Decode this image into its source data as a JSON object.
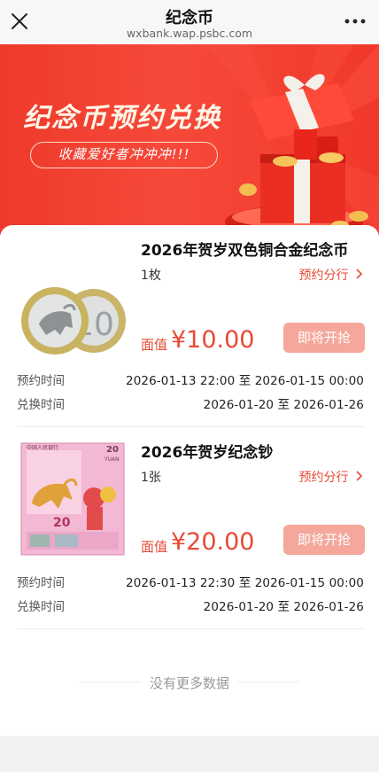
{
  "nav": {
    "title": "纪念币",
    "url": "wxbank.wap.psbc.com"
  },
  "banner": {
    "title": "纪念币预约兑换",
    "tagline": "收藏爱好者冲冲冲!!!"
  },
  "items": [
    {
      "name": "2026年贺岁双色铜合金纪念币",
      "quantity": "1枚",
      "branch_link": "预约分行",
      "price_label": "面值",
      "price": "¥10.00",
      "button": "即将开抢",
      "reserve_label": "预约时间",
      "reserve_start": "2026-01-13 22:00",
      "reserve_to": "至",
      "reserve_end": "2026-01-15 00:00",
      "exchange_label": "兑换时间",
      "exchange_start": "2026-01-20",
      "exchange_to": "至",
      "exchange_end": "2026-01-26"
    },
    {
      "name": "2026年贺岁纪念钞",
      "quantity": "1张",
      "branch_link": "预约分行",
      "price_label": "面值",
      "price": "¥20.00",
      "button": "即将开抢",
      "reserve_label": "预约时间",
      "reserve_start": "2026-01-13 22:30",
      "reserve_to": "至",
      "reserve_end": "2026-01-15 00:00",
      "exchange_label": "兑换时间",
      "exchange_start": "2026-01-20",
      "exchange_to": "至",
      "exchange_end": "2026-01-26",
      "note_text_top": "中国人民银行",
      "note_denom": "20",
      "note_yuan": "YUAN"
    }
  ],
  "footer": {
    "no_more": "没有更多数据"
  },
  "colors": {
    "accent": "#e84a35",
    "button_disabled": "#f5a79b",
    "banner": "#f0392b"
  }
}
